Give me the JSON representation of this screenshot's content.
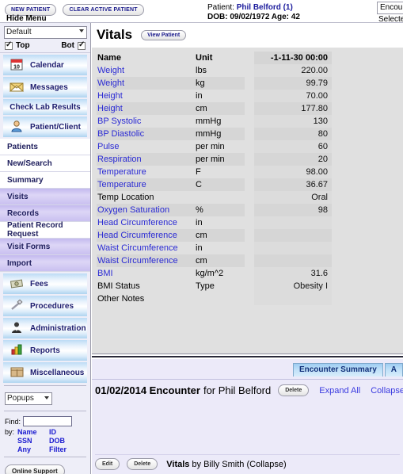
{
  "topbar": {
    "new_patient_label": "NEW PATIENT",
    "clear_patient_label": "CLEAR ACTIVE PATIENT",
    "hide_menu_label": "Hide Menu",
    "patient_prefix": "Patient:",
    "patient_name": "Phil Belford (1)",
    "dob_line": "DOB: 09/02/1972 Age: 42",
    "encounter_field_value": "Encounter",
    "selected_encounter_label": "Selected En"
  },
  "sidebar": {
    "theme_select_value": "Default",
    "top_label": "Top",
    "bot_label": "Bot",
    "big_items": [
      {
        "label": "Calendar",
        "icon": "calendar-icon"
      },
      {
        "label": "Messages",
        "icon": "envelope-icon"
      }
    ],
    "lab_band_label": "Check Lab Results",
    "patient_client_label": "Patient/Client",
    "patient_client_icon": "person-icon",
    "nav_items": [
      {
        "label": "Patients",
        "style": "white"
      },
      {
        "label": "New/Search",
        "style": "white"
      },
      {
        "label": "Summary",
        "style": "white"
      },
      {
        "label": "Visits",
        "style": "purple"
      },
      {
        "label": "Records",
        "style": "purple"
      },
      {
        "label": "Patient Record Request",
        "style": "white"
      },
      {
        "label": "Visit Forms",
        "style": "purple"
      },
      {
        "label": "Import",
        "style": "purple"
      }
    ],
    "module_items": [
      {
        "label": "Fees",
        "icon": "money-icon"
      },
      {
        "label": "Procedures",
        "icon": "syringe-icon"
      },
      {
        "label": "Administration",
        "icon": "admin-person-icon"
      },
      {
        "label": "Reports",
        "icon": "chart-icon"
      },
      {
        "label": "Miscellaneous",
        "icon": "box-icon"
      }
    ],
    "popups_select_value": "Popups",
    "find_label": "Find:",
    "find_value": "",
    "by_label": "by:",
    "by_links": [
      "Name",
      "ID",
      "SSN",
      "DOB",
      "Any",
      "Filter"
    ],
    "support_label": "Online Support"
  },
  "main": {
    "title": "Vitals",
    "view_patient_label": "View Patient",
    "columns": [
      "Name",
      "Unit",
      "-1-11-30 00:00"
    ],
    "rows": [
      {
        "name": "Weight",
        "link": true,
        "unit": "lbs",
        "value": "220.00"
      },
      {
        "name": "Weight",
        "link": true,
        "unit": "kg",
        "value": "99.79"
      },
      {
        "name": "Height",
        "link": true,
        "unit": "in",
        "value": "70.00"
      },
      {
        "name": "Height",
        "link": true,
        "unit": "cm",
        "value": "177.80"
      },
      {
        "name": "BP Systolic",
        "link": true,
        "unit": "mmHg",
        "value": "130"
      },
      {
        "name": "BP Diastolic",
        "link": true,
        "unit": "mmHg",
        "value": "80"
      },
      {
        "name": "Pulse",
        "link": true,
        "unit": "per min",
        "value": "60"
      },
      {
        "name": "Respiration",
        "link": true,
        "unit": "per min",
        "value": "20"
      },
      {
        "name": "Temperature",
        "link": true,
        "unit": "F",
        "value": "98.00"
      },
      {
        "name": "Temperature",
        "link": true,
        "unit": "C",
        "value": "36.67"
      },
      {
        "name": "Temp Location",
        "link": false,
        "unit": "",
        "value": "Oral"
      },
      {
        "name": "Oxygen Saturation",
        "link": true,
        "unit": "%",
        "value": "98"
      },
      {
        "name": "Head Circumference",
        "link": true,
        "unit": "in",
        "value": ""
      },
      {
        "name": "Head Circumference",
        "link": true,
        "unit": "cm",
        "value": ""
      },
      {
        "name": "Waist Circumference",
        "link": true,
        "unit": "in",
        "value": ""
      },
      {
        "name": "Waist Circumference",
        "link": true,
        "unit": "cm",
        "value": ""
      },
      {
        "name": "BMI",
        "link": true,
        "unit": "kg/m^2",
        "value": "31.6"
      },
      {
        "name": "BMI Status",
        "link": false,
        "unit": "Type",
        "value": "Obesity I"
      },
      {
        "name": "Other Notes",
        "link": false,
        "unit": "",
        "value": ""
      }
    ]
  },
  "bottom": {
    "tabs": [
      {
        "label": "Encounter Summary",
        "active": true
      },
      {
        "label": "A",
        "active": false
      }
    ],
    "encounter_date": "01/02/2014 Encounter",
    "encounter_for": "for Phil Belford",
    "delete_label": "Delete",
    "expand_all_label": "Expand All",
    "collapse_all_label": "Collapse All",
    "form": {
      "edit_label": "Edit",
      "delete_label": "Delete",
      "name": "Vitals",
      "by": "by Billy Smith (Collapse)"
    }
  },
  "colors": {
    "link_blue": "#2a2ad4",
    "nav_purple": "#c3b9ee",
    "tab_blue": "#9ecdf2",
    "panel_gray": "#e0e0e0",
    "sidebar_bg": "#eeeef8",
    "bottom_bg": "#eceaf9"
  }
}
